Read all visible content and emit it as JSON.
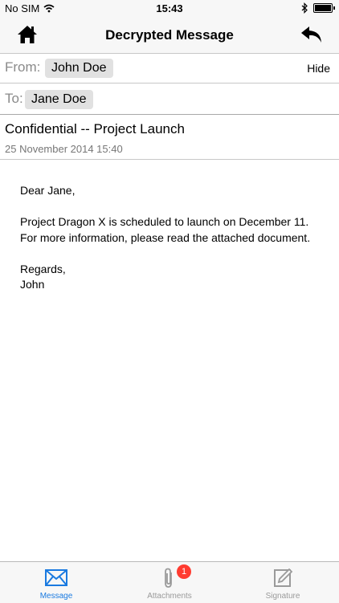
{
  "status_bar": {
    "carrier": "No SIM",
    "time": "15:43"
  },
  "nav": {
    "title": "Decrypted Message"
  },
  "header": {
    "from_label": "From:",
    "from_value": "John Doe",
    "hide_label": "Hide",
    "to_label": "To:",
    "to_value": "Jane Doe"
  },
  "message": {
    "subject": "Confidential -- Project Launch",
    "date": "25 November 2014 15:40",
    "greeting": "Dear Jane,",
    "paragraph": "Project Dragon X is scheduled to launch on December 11. For more information, please read the attached document.",
    "closing": "Regards,",
    "signature": "John"
  },
  "tabs": [
    {
      "label": "Message",
      "icon": "envelope-icon",
      "active": true
    },
    {
      "label": "Attachments",
      "icon": "paperclip-icon",
      "badge": "1"
    },
    {
      "label": "Signature",
      "icon": "signature-pen-icon"
    }
  ],
  "colors": {
    "accent": "#1a7ae0",
    "badge": "#ff3b30",
    "chip": "#e1e1e1"
  }
}
